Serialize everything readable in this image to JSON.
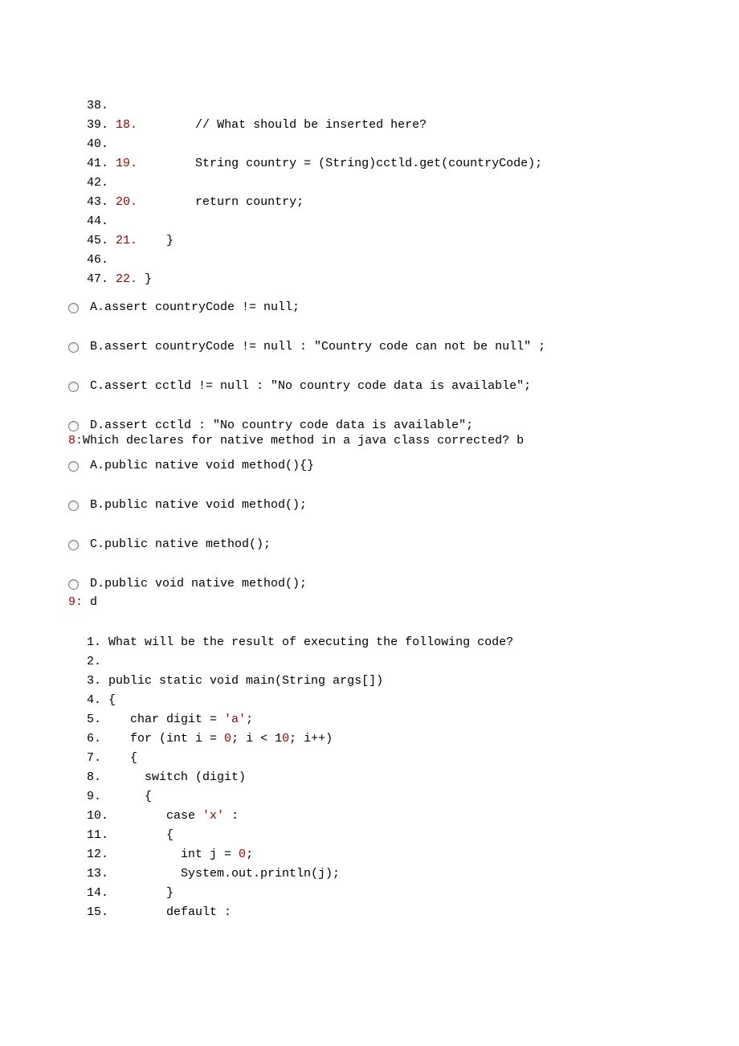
{
  "block1": {
    "lines": [
      {
        "g": "38.",
        "innum": "",
        "body": ""
      },
      {
        "g": "39.",
        "innum": "18.",
        "body": "        // What should be inserted here?"
      },
      {
        "g": "40.",
        "innum": "",
        "body": ""
      },
      {
        "g": "41.",
        "innum": "19.",
        "body": "        String country = (String)cctld.get(countryCode);"
      },
      {
        "g": "42.",
        "innum": "",
        "body": ""
      },
      {
        "g": "43.",
        "innum": "20.",
        "body": "        return country;"
      },
      {
        "g": "44.",
        "innum": "",
        "body": ""
      },
      {
        "g": "45.",
        "innum": "21.",
        "body": "    }"
      },
      {
        "g": "46.",
        "innum": "",
        "body": ""
      },
      {
        "g": "47.",
        "innum": "22.",
        "body": " }"
      }
    ]
  },
  "options7": [
    "A.assert countryCode != null;",
    "B.assert countryCode != null : \"Country code can not be null\" ;",
    "C.assert cctld != null : \"No country code data is available\";",
    "D.assert cctld : \"No country code data is available\";"
  ],
  "q8": {
    "prefix": "8:",
    "text": "Which declares for native method in a java class corrected? b"
  },
  "options8": [
    "A.public native void method(){}",
    "B.public native void method();",
    "C.public native method();",
    "D.public void native method();"
  ],
  "q9": {
    "prefix": "9:",
    "text": " d"
  },
  "block2": {
    "lines": [
      {
        "g": "1.",
        "body": " What will be the result of executing the following code?",
        "literals": []
      },
      {
        "g": "2.",
        "body": "",
        "literals": []
      },
      {
        "g": "3.",
        "body": " public static void main(String args[])",
        "literals": []
      },
      {
        "g": "4.",
        "body": " {",
        "literals": []
      },
      {
        "g": "5.",
        "body": "    char digit = 'a';",
        "literals": [
          "'a'"
        ]
      },
      {
        "g": "6.",
        "body": "    for (int i = 0; i < 10; i++)",
        "literals": [
          "0",
          "10"
        ]
      },
      {
        "g": "7.",
        "body": "    {",
        "literals": []
      },
      {
        "g": "8.",
        "body": "      switch (digit)",
        "literals": []
      },
      {
        "g": "9.",
        "body": "      {",
        "literals": []
      },
      {
        "g": "10.",
        "body": "        case 'x' :",
        "literals": [
          "'x'"
        ]
      },
      {
        "g": "11.",
        "body": "        {",
        "literals": []
      },
      {
        "g": "12.",
        "body": "          int j = 0;",
        "literals": [
          "0"
        ]
      },
      {
        "g": "13.",
        "body": "          System.out.println(j);",
        "literals": []
      },
      {
        "g": "14.",
        "body": "        }",
        "literals": []
      },
      {
        "g": "15.",
        "body": "        default :",
        "literals": []
      }
    ]
  }
}
